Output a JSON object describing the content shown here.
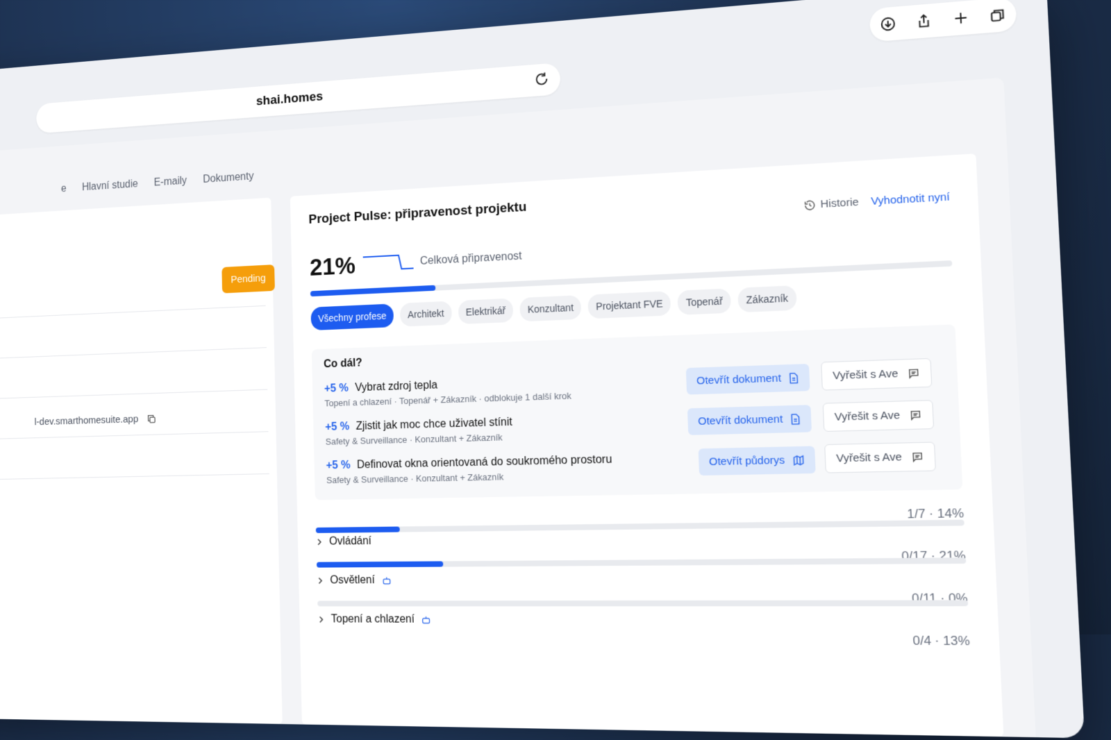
{
  "browser": {
    "url": "shai.homes"
  },
  "nav": {
    "tabs": [
      "e",
      "Hlavní studie",
      "E-maily",
      "Dokumenty"
    ]
  },
  "left": {
    "status": "Pending",
    "dev_url": "l-dev.smarthomesuite.app"
  },
  "pulse": {
    "title": "Project Pulse: připravenost projektu",
    "history": "Historie",
    "evaluate": "Vyhodnotit nyní",
    "percent_text": "21%",
    "percent_value": 21,
    "percent_label": "Celková připravenost",
    "chips": [
      "Všechny profese",
      "Architekt",
      "Elektrikář",
      "Konzultant",
      "Projektant FVE",
      "Topenář",
      "Zákazník"
    ],
    "active_chip": "Všechny profese",
    "next_title": "Co dál?",
    "items": [
      {
        "plus": "+5 %",
        "title": "Vybrat zdroj tepla",
        "meta": "Topení a chlazení · Topenář + Zákazník · odblokuje 1 další krok",
        "open": "Otevřít dokument",
        "ave": "Vyřešit s Ave"
      },
      {
        "plus": "+5 %",
        "title": "Zjistit jak moc chce uživatel stínit",
        "meta": "Safety & Surveillance · Konzultant + Zákazník",
        "open": "Otevřít dokument",
        "ave": "Vyřešit s Ave"
      },
      {
        "plus": "+5 %",
        "title": "Definovat okna orientovaná do soukromého prostoru",
        "meta": "Safety & Surveillance · Konzultant + Zákazník",
        "open": "Otevřít půdorys",
        "ave": "Vyřešit s Ave"
      }
    ],
    "sections": [
      {
        "name": "Ovládání",
        "ratio": "1/7 · 14%",
        "value": 14,
        "robot": false
      },
      {
        "name": "Osvětlení",
        "ratio": "0/17 · 21%",
        "value": 21,
        "robot": true
      },
      {
        "name": "Topení a chlazení",
        "ratio": "0/11 · 0%",
        "value": 0,
        "robot": true
      }
    ],
    "extra_ratio": "0/4 · 13%"
  },
  "icons": [
    "reload-icon",
    "download-icon",
    "share-icon",
    "plus-icon",
    "tabs-icon",
    "history-icon",
    "document-icon",
    "map-icon",
    "chat-icon",
    "chevron-right-icon",
    "robot-icon",
    "copy-icon",
    "reader-icon"
  ],
  "colors": {
    "accent": "#1d5cf0",
    "pending": "#f59e0b"
  }
}
